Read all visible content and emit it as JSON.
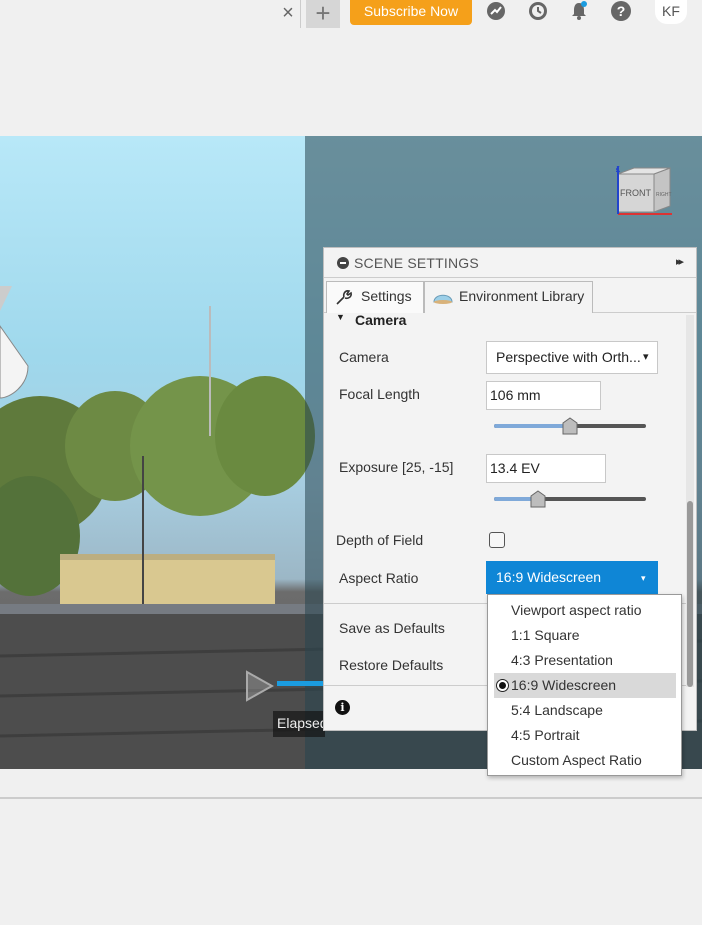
{
  "topbar": {
    "close_glyph": "×",
    "newtab_glyph": "+",
    "subscribe_label": "Subscribe Now",
    "icons": [
      "job-status-icon",
      "history-icon",
      "notifications-icon",
      "help-icon"
    ],
    "avatar_initials": "KF"
  },
  "viewcube": {
    "face_label": "FRONT",
    "side_label": "RIGHT",
    "z_axis": "Z"
  },
  "panel": {
    "title": "SCENE SETTINGS",
    "expand_glyph": "▸▸",
    "tabs": [
      {
        "label": "Settings",
        "icon": "wrench-icon"
      },
      {
        "label": "Environment Library",
        "icon": "dome-icon"
      }
    ],
    "section": {
      "label": "Camera",
      "arrow": "▼"
    },
    "camera": {
      "label": "Camera",
      "value": "Perspective with Orth...",
      "arrow": "▾"
    },
    "focal_length": {
      "label": "Focal Length",
      "value": "106 mm",
      "slider_fraction": 0.5
    },
    "exposure": {
      "label": "Exposure [25, -15]",
      "value": "13.4 EV",
      "slider_fraction": 0.29
    },
    "depth_of_field": {
      "label": "Depth of Field",
      "checked": false
    },
    "aspect_ratio": {
      "label": "Aspect Ratio",
      "value": "16:9 Widescreen",
      "arrow": "▾"
    },
    "save_defaults": "Save as Defaults",
    "restore_defaults": "Restore Defaults",
    "info_glyph": "i"
  },
  "aspect_dropdown": {
    "options": [
      "Viewport aspect ratio",
      "1:1 Square",
      "4:3 Presentation",
      "16:9 Widescreen",
      "5:4 Landscape",
      "4:5 Portrait",
      "Custom Aspect Ratio"
    ],
    "selected": "16:9 Widescreen"
  },
  "playback": {
    "elapsed_label": "Elapsed"
  },
  "colors": {
    "accent_blue": "#0f86d6",
    "subscribe_orange": "#f5a01a",
    "timeline_blue": "#1b9ce0"
  }
}
